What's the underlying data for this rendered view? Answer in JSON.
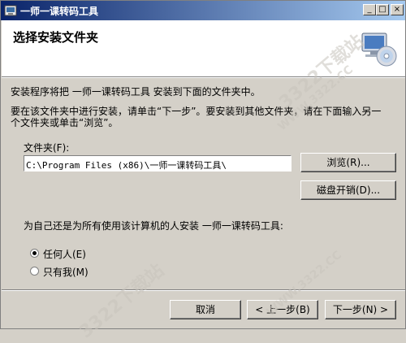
{
  "window": {
    "title": "一师一课转码工具",
    "minimize_label": "_",
    "maximize_label": "□",
    "close_label": "×"
  },
  "header": {
    "title": "选择安装文件夹"
  },
  "body": {
    "intro": "安装程序将把 一师一课转码工具 安装到下面的文件夹中。",
    "instruction_line1": "要在该文件夹中进行安装，请单击“下一步”。要安装到其他文件夹，请在下面输入另一",
    "instruction_line2": "个文件夹或单击“浏览”。",
    "folder_label": "文件夹(F):",
    "folder_value": "C:\\Program Files (x86)\\一师一课转码工具\\",
    "browse_button": "浏览(R)...",
    "disk_cost_button": "磁盘开销(D)...",
    "scope_question": "为自己还是为所有使用该计算机的人安装 一师一课转码工具:",
    "option_everyone": "任何人(E)",
    "option_just_me": "只有我(M)",
    "selected_option": "everyone"
  },
  "footer": {
    "cancel_button": "取消",
    "back_button": "< 上一步(B)",
    "next_button": "下一步(N) >"
  },
  "watermark": {
    "text_top": "3322下载站",
    "text_top_url": "WWW.3322.CC",
    "text_bottom": "3322下载站",
    "text_bottom_url": "WWW.3322.CC"
  }
}
